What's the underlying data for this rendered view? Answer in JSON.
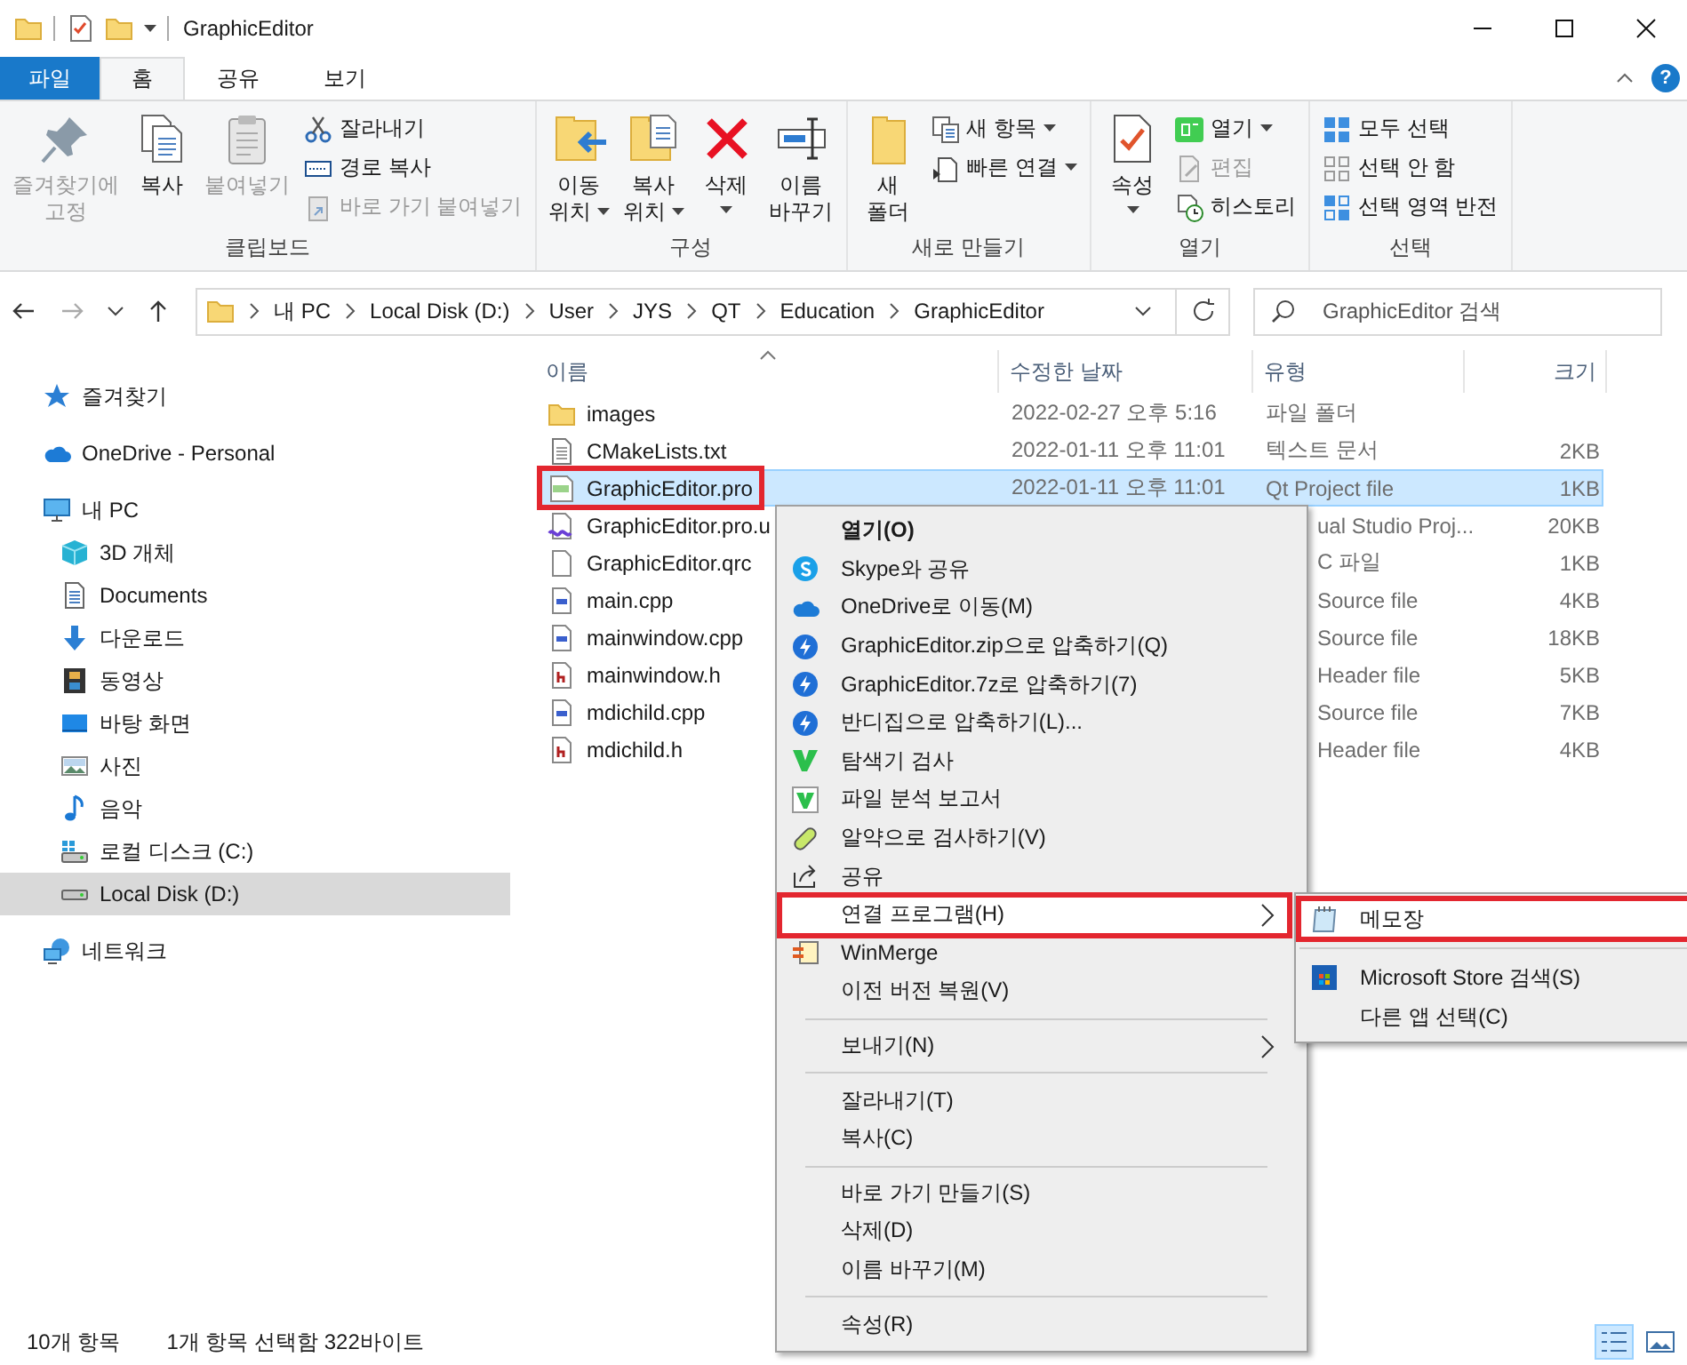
{
  "window": {
    "title": "GraphicEditor"
  },
  "ribbon_tabs": [
    {
      "label": "파일",
      "kind": "file"
    },
    {
      "label": "홈",
      "kind": "tab",
      "selected": true
    },
    {
      "label": "공유",
      "kind": "tab",
      "selected": false
    },
    {
      "label": "보기",
      "kind": "tab",
      "selected": false
    }
  ],
  "help_button": "?",
  "ribbon_groups": [
    {
      "label": "클립보드",
      "large": [
        {
          "lines": [
            "즐겨찾기에",
            "고정"
          ],
          "disabled": true,
          "dropdown": false
        },
        {
          "lines": [
            "복사"
          ],
          "disabled": false,
          "dropdown": false
        },
        {
          "lines": [
            "붙여넣기"
          ],
          "disabled": true,
          "dropdown": false
        }
      ],
      "small": [
        {
          "label": "잘라내기",
          "disabled": false,
          "dropdown": false
        },
        {
          "label": "경로 복사",
          "disabled": false,
          "dropdown": false
        },
        {
          "label": "바로 가기 붙여넣기",
          "disabled": true,
          "dropdown": false
        }
      ]
    },
    {
      "label": "구성",
      "large": [
        {
          "lines": [
            "이동",
            "위치"
          ],
          "disabled": false,
          "dropdown": true
        },
        {
          "lines": [
            "복사",
            "위치"
          ],
          "disabled": false,
          "dropdown": true
        },
        {
          "lines": [
            "삭제"
          ],
          "disabled": false,
          "dropdown": true
        },
        {
          "lines": [
            "이름",
            "바꾸기"
          ],
          "disabled": false,
          "dropdown": false
        }
      ]
    },
    {
      "label": "새로 만들기",
      "large": [
        {
          "lines": [
            "새",
            "폴더"
          ],
          "disabled": false,
          "dropdown": false
        }
      ],
      "small": [
        {
          "label": "새 항목",
          "disabled": false,
          "dropdown": true
        },
        {
          "label": "빠른 연결",
          "disabled": false,
          "dropdown": true
        }
      ]
    },
    {
      "label": "열기",
      "large": [
        {
          "lines": [
            "속성"
          ],
          "disabled": false,
          "dropdown": true
        }
      ],
      "small": [
        {
          "label": "열기",
          "disabled": false,
          "dropdown": true
        },
        {
          "label": "편집",
          "disabled": true,
          "dropdown": false
        },
        {
          "label": "히스토리",
          "disabled": false,
          "dropdown": false
        }
      ]
    },
    {
      "label": "선택",
      "small": [
        {
          "label": "모두 선택",
          "disabled": false,
          "dropdown": false
        },
        {
          "label": "선택 안 함",
          "disabled": false,
          "dropdown": false
        },
        {
          "label": "선택 영역 반전",
          "disabled": false,
          "dropdown": false
        }
      ]
    }
  ],
  "address": {
    "path": [
      "내 PC",
      "Local Disk (D:)",
      "User",
      "JYS",
      "QT",
      "Education",
      "GraphicEditor"
    ]
  },
  "search": {
    "placeholder": "GraphicEditor 검색"
  },
  "nav": [
    {
      "label": "즐겨찾기",
      "selected": false
    },
    {
      "label": "OneDrive - Personal",
      "selected": false
    },
    {
      "label": "내 PC",
      "selected": false,
      "children": [
        {
          "label": "3D 개체",
          "selected": false
        },
        {
          "label": "Documents",
          "selected": false
        },
        {
          "label": "다운로드",
          "selected": false
        },
        {
          "label": "동영상",
          "selected": false
        },
        {
          "label": "바탕 화면",
          "selected": false
        },
        {
          "label": "사진",
          "selected": false
        },
        {
          "label": "음악",
          "selected": false
        },
        {
          "label": "로컬 디스크 (C:)",
          "selected": false
        },
        {
          "label": "Local Disk (D:)",
          "selected": true
        }
      ]
    },
    {
      "label": "네트워크",
      "selected": false
    }
  ],
  "columns": [
    "이름",
    "수정한 날짜",
    "유형",
    "크기"
  ],
  "files": [
    {
      "name": "images",
      "date": "2022-02-27 오후 5:16",
      "type": "파일 폴더",
      "selected": false,
      "marked": false
    },
    {
      "name": "CMakeLists.txt",
      "date": "2022-01-11 오후 11:01",
      "type": "텍스트 문서",
      "size": "2KB",
      "selected": false,
      "marked": false
    },
    {
      "name": "GraphicEditor.pro",
      "date": "2022-01-11 오후 11:01",
      "type": "Qt Project file",
      "size": "1KB",
      "selected": true,
      "marked": true
    },
    {
      "name": "GraphicEditor.pro.u",
      "type": "ual Studio Proj...",
      "size": "20KB",
      "selected": false,
      "marked": false
    },
    {
      "name": "GraphicEditor.qrc",
      "type": "C 파일",
      "size": "1KB",
      "selected": false,
      "marked": false
    },
    {
      "name": "main.cpp",
      "type": "Source file",
      "size": "4KB",
      "selected": false,
      "marked": false
    },
    {
      "name": "mainwindow.cpp",
      "type": "Source file",
      "size": "18KB",
      "selected": false,
      "marked": false
    },
    {
      "name": "mainwindow.h",
      "type": "Header file",
      "size": "5KB",
      "selected": false,
      "marked": false
    },
    {
      "name": "mdichild.cpp",
      "type": "Source file",
      "size": "7KB",
      "selected": false,
      "marked": false
    },
    {
      "name": "mdichild.h",
      "type": "Header file",
      "size": "4KB",
      "selected": false,
      "marked": false
    }
  ],
  "context_menu": [
    {
      "kind": "item",
      "label": "열기(O)",
      "default": true,
      "submenu": false,
      "marked": false
    },
    {
      "kind": "item",
      "label": "Skype와 공유",
      "default": false,
      "submenu": false,
      "marked": false
    },
    {
      "kind": "item",
      "label": "OneDrive로 이동(M)",
      "default": false,
      "submenu": false,
      "marked": false
    },
    {
      "kind": "item",
      "label": "GraphicEditor.zip으로 압축하기(Q)",
      "default": false,
      "submenu": false,
      "marked": false
    },
    {
      "kind": "item",
      "label": "GraphicEditor.7z로 압축하기(7)",
      "default": false,
      "submenu": false,
      "marked": false
    },
    {
      "kind": "item",
      "label": "반디집으로 압축하기(L)...",
      "default": false,
      "submenu": false,
      "marked": false
    },
    {
      "kind": "item",
      "label": "탐색기 검사",
      "default": false,
      "submenu": false,
      "marked": false
    },
    {
      "kind": "item",
      "label": "파일 분석 보고서",
      "default": false,
      "submenu": false,
      "marked": false
    },
    {
      "kind": "item",
      "label": "알약으로 검사하기(V)",
      "default": false,
      "submenu": false,
      "marked": false
    },
    {
      "kind": "item",
      "label": "공유",
      "default": false,
      "submenu": false,
      "marked": false
    },
    {
      "kind": "item",
      "label": "연결 프로그램(H)",
      "default": false,
      "submenu": true,
      "marked": true
    },
    {
      "kind": "item",
      "label": "WinMerge",
      "default": false,
      "submenu": false,
      "marked": false
    },
    {
      "kind": "item",
      "label": "이전 버전 복원(V)",
      "default": false,
      "submenu": false,
      "marked": false
    },
    {
      "kind": "separator"
    },
    {
      "kind": "item",
      "label": "보내기(N)",
      "default": false,
      "submenu": true,
      "marked": false
    },
    {
      "kind": "separator"
    },
    {
      "kind": "item",
      "label": "잘라내기(T)",
      "default": false,
      "submenu": false,
      "marked": false
    },
    {
      "kind": "item",
      "label": "복사(C)",
      "default": false,
      "submenu": false,
      "marked": false
    },
    {
      "kind": "separator"
    },
    {
      "kind": "item",
      "label": "바로 가기 만들기(S)",
      "default": false,
      "submenu": false,
      "marked": false
    },
    {
      "kind": "item",
      "label": "삭제(D)",
      "default": false,
      "submenu": false,
      "marked": false
    },
    {
      "kind": "item",
      "label": "이름 바꾸기(M)",
      "default": false,
      "submenu": false,
      "marked": false
    },
    {
      "kind": "separator"
    },
    {
      "kind": "item",
      "label": "속성(R)",
      "default": false,
      "submenu": false,
      "marked": false
    }
  ],
  "open_with_menu": [
    {
      "kind": "item",
      "label": "메모장",
      "marked": true
    },
    {
      "kind": "separator"
    },
    {
      "kind": "item",
      "label": "Microsoft Store 검색(S)",
      "marked": false
    },
    {
      "kind": "item",
      "label": "다른 앱 선택(C)",
      "marked": false
    }
  ],
  "status_bar": {
    "item_count": "10개 항목",
    "selection": "1개 항목 선택함 322바이트",
    "views": [
      {
        "selected": true
      },
      {
        "selected": false
      }
    ]
  }
}
